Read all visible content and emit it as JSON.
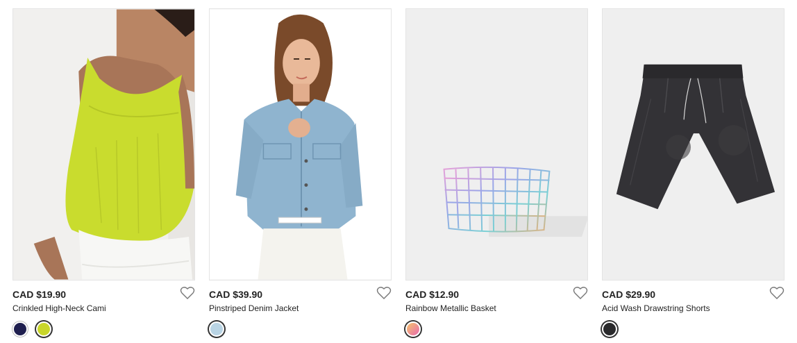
{
  "products": [
    {
      "price": "CAD $19.90",
      "name": "Crinkled High-Neck Cami",
      "image": "model-yellow-cami",
      "swatches": [
        {
          "color": "#1f1f4f",
          "selected": false
        },
        {
          "color": "#c9d62a",
          "selected": true
        }
      ]
    },
    {
      "price": "CAD $39.90",
      "name": "Pinstriped Denim Jacket",
      "image": "model-denim-jacket",
      "swatches": [
        {
          "color": "#b9d4e4",
          "selected": true
        }
      ]
    },
    {
      "price": "CAD $12.90",
      "name": "Rainbow Metallic Basket",
      "image": "rainbow-wire-basket",
      "swatches": [
        {
          "color": "linear-gradient(135deg,#f5c46b,#e86ab0)",
          "selected": true
        }
      ]
    },
    {
      "price": "CAD $29.90",
      "name": "Acid Wash Drawstring Shorts",
      "image": "black-acid-wash-shorts",
      "swatches": [
        {
          "color": "#2a2a2c",
          "selected": true
        }
      ]
    }
  ],
  "icons": {
    "favorite": "heart-outline-icon"
  }
}
